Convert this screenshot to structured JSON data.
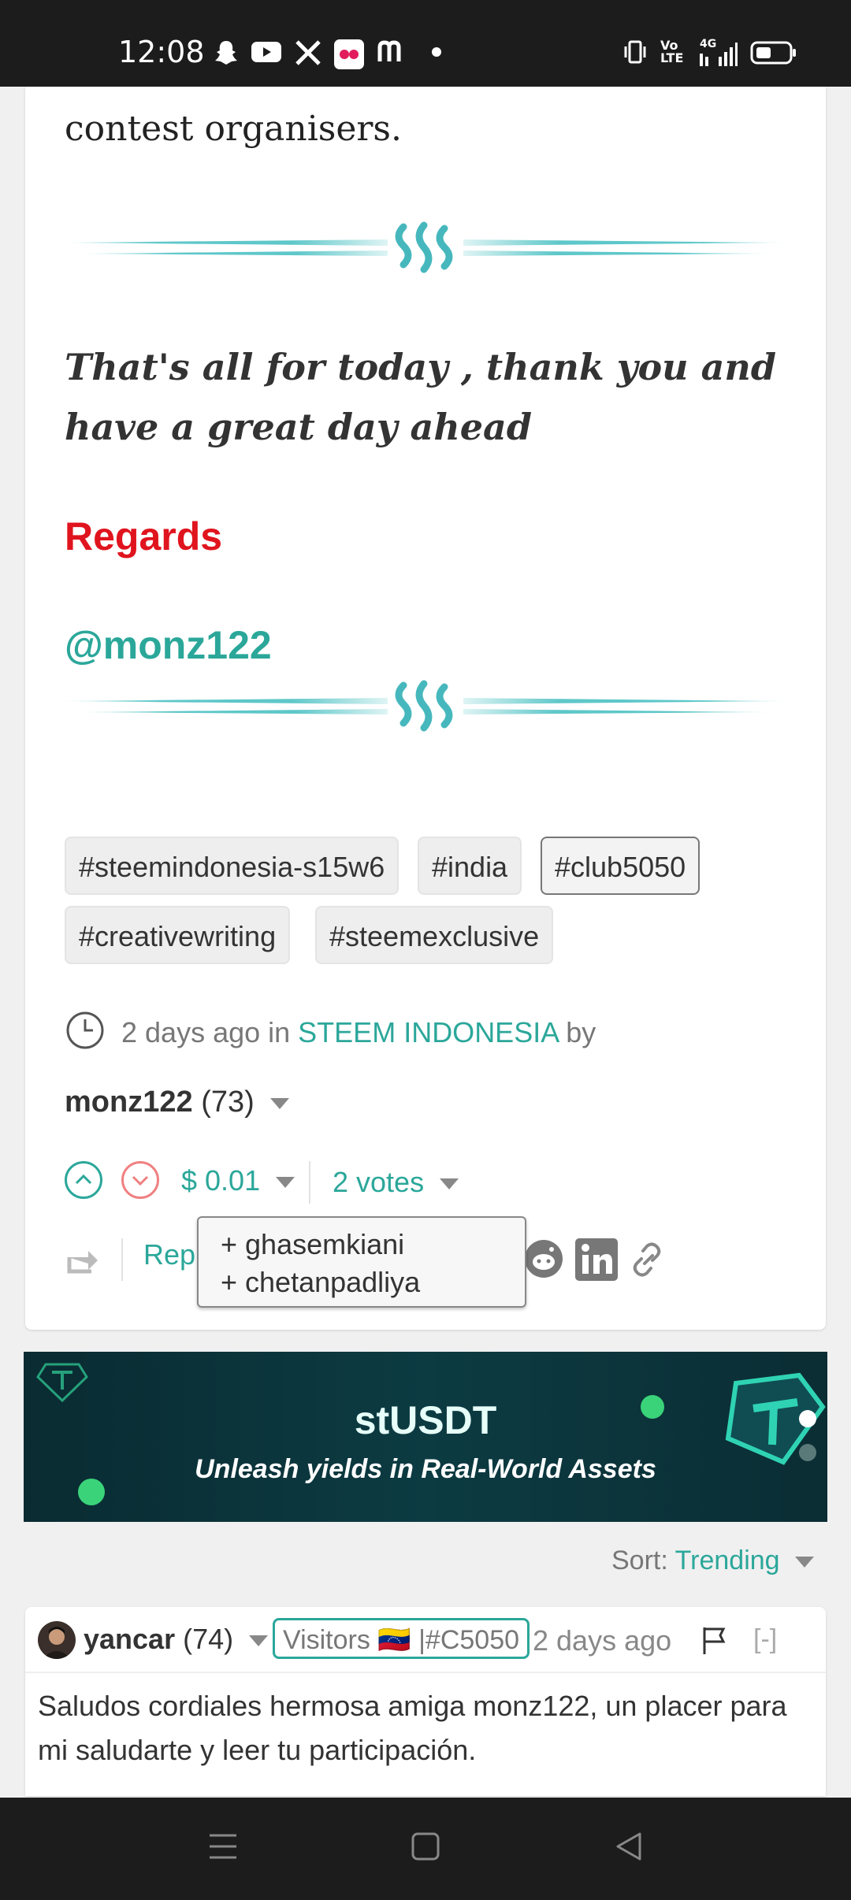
{
  "status_bar": {
    "time": "12:08",
    "notification_icons": [
      "snapchat-icon",
      "youtube-icon",
      "x-icon",
      "flickr-icon",
      "medium-icon",
      "dot-icon"
    ],
    "system_icons": [
      "vibrate-icon",
      "volte-icon",
      "signal-4g-icon",
      "battery-icon"
    ],
    "vo_label": "Vo",
    "lte_label": "LTE",
    "network_label": "4G"
  },
  "post": {
    "text_top": "contest organisers.",
    "closing": "That's all for today , thank you and have a great day ahead",
    "regards": "Regards",
    "author_handle": "@monz122",
    "tags": [
      "#steemindonesia-s15w6",
      "#india",
      "#club5050",
      "#creativewriting",
      "#steemexclusive"
    ],
    "active_tag": "#club5050",
    "meta": {
      "prefix": "2 days ago in",
      "community": "STEEM INDONESIA",
      "suffix": "by"
    },
    "author": {
      "name": "monz122",
      "reputation": "(73)"
    },
    "payout": "$ 0.01",
    "votes": "2 votes",
    "reply_label": "Rep",
    "voters": [
      "+ ghasemkiani",
      "+ chetanpadliya"
    ]
  },
  "ad": {
    "title": "stUSDT",
    "subtitle": "Unleash yields in Real-World Assets"
  },
  "sort": {
    "label": "Sort:",
    "value": "Trending"
  },
  "comment": {
    "user": "yancar",
    "reputation": "(74)",
    "badge": "Visitors 🇻🇪 |#C5050",
    "time": "2 days ago",
    "collapse": "[-]",
    "body": "Saludos cordiales hermosa amiga monz122, un placer para mi saludarte y leer tu participación."
  },
  "colors": {
    "accent": "#2ba79a",
    "regards": "#e0141e",
    "downvote": "#f08080"
  }
}
